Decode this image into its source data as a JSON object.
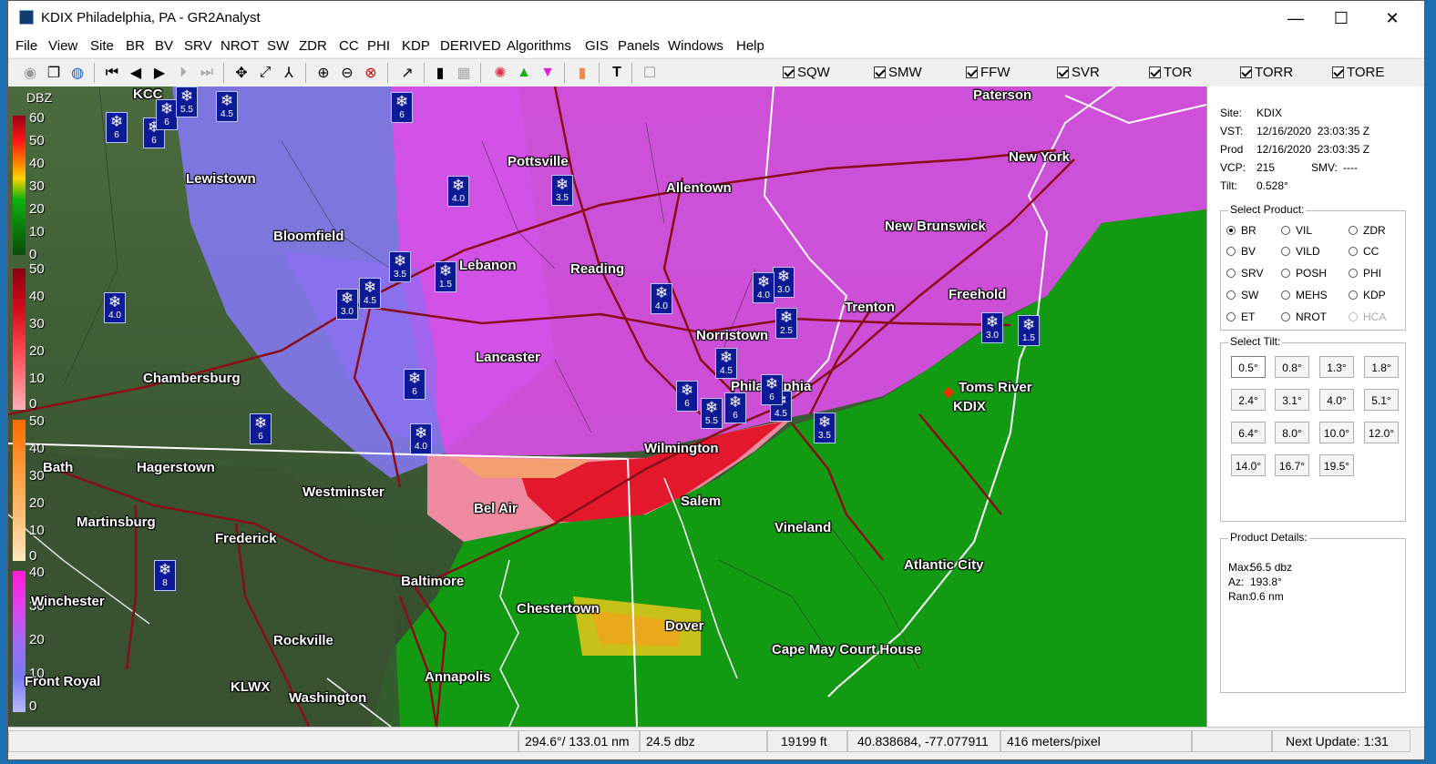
{
  "window": {
    "title": "KDIX Philadelphia, PA - GR2Analyst",
    "minimize": "—",
    "maximize": "☐",
    "close": "✕"
  },
  "menu": [
    "File",
    "View",
    "Site",
    "BR",
    "BV",
    "SRV",
    "NROT",
    "SW",
    "ZDR",
    "CC",
    "PHI",
    "KDP",
    "DERIVED",
    "Algorithms",
    "GIS",
    "Panels",
    "Windows",
    "Help"
  ],
  "warnings": [
    {
      "label": "SQW",
      "checked": true
    },
    {
      "label": "SMW",
      "checked": true
    },
    {
      "label": "FFW",
      "checked": true
    },
    {
      "label": "SVR",
      "checked": true
    },
    {
      "label": "TOR",
      "checked": true
    },
    {
      "label": "TORR",
      "checked": true
    },
    {
      "label": "TORE",
      "checked": true
    }
  ],
  "legend": {
    "title": "DBZ",
    "rain_ticks": [
      "60",
      "50",
      "40",
      "30",
      "20",
      "10",
      "0"
    ],
    "ice_ticks": [
      "50",
      "40",
      "30",
      "20",
      "10",
      "0"
    ],
    "mix_ticks": [
      "50",
      "40",
      "30",
      "20",
      "10",
      "0"
    ],
    "snow_ticks": [
      "40",
      "30",
      "20",
      "10",
      "0"
    ]
  },
  "cities": [
    {
      "name": "KCC"
    },
    {
      "name": "Lewistown"
    },
    {
      "name": "Pottsville"
    },
    {
      "name": "Allentown"
    },
    {
      "name": "Paterson"
    },
    {
      "name": "New York"
    },
    {
      "name": "New Brunswick"
    },
    {
      "name": "Bloomfield"
    },
    {
      "name": "Lebanon"
    },
    {
      "name": "Reading"
    },
    {
      "name": "Trenton"
    },
    {
      "name": "Freehold"
    },
    {
      "name": "Norristown"
    },
    {
      "name": "Lancaster"
    },
    {
      "name": "Chambersburg"
    },
    {
      "name": "Philadelphia"
    },
    {
      "name": "Toms River"
    },
    {
      "name": "KDIX"
    },
    {
      "name": "Wilmington"
    },
    {
      "name": "Hagerstown"
    },
    {
      "name": "Westminster"
    },
    {
      "name": "Bel Air"
    },
    {
      "name": "Salem"
    },
    {
      "name": "Martinsburg"
    },
    {
      "name": "Frederick"
    },
    {
      "name": "Vineland"
    },
    {
      "name": "Atlantic City"
    },
    {
      "name": "Baltimore"
    },
    {
      "name": "Chestertown"
    },
    {
      "name": "Winchester"
    },
    {
      "name": "Dover"
    },
    {
      "name": "Rockville"
    },
    {
      "name": "Cape May Court House"
    },
    {
      "name": "Annapolis"
    },
    {
      "name": "KLWX"
    },
    {
      "name": "Washington"
    },
    {
      "name": "Bath"
    },
    {
      "name": "Front Royal"
    }
  ],
  "snow_markers": [
    {
      "value": "6"
    },
    {
      "value": "6"
    },
    {
      "value": "6"
    },
    {
      "value": "4.5"
    },
    {
      "value": "5.5"
    },
    {
      "value": "6"
    },
    {
      "value": "4.0"
    },
    {
      "value": "3.5"
    },
    {
      "value": "3.5"
    },
    {
      "value": "1.5"
    },
    {
      "value": "3.0"
    },
    {
      "value": "4.5"
    },
    {
      "value": "4.0"
    },
    {
      "value": "4.0"
    },
    {
      "value": "3.0"
    },
    {
      "value": "4.0"
    },
    {
      "value": "2.5"
    },
    {
      "value": "3.0"
    },
    {
      "value": "1.5"
    },
    {
      "value": "4.5"
    },
    {
      "value": "6"
    },
    {
      "value": "6"
    },
    {
      "value": "5.5"
    },
    {
      "value": "6"
    },
    {
      "value": "4.5"
    },
    {
      "value": "3.5"
    },
    {
      "value": "6"
    },
    {
      "value": "4.0"
    },
    {
      "value": "6"
    },
    {
      "value": "8"
    }
  ],
  "site_info": {
    "site_label": "Site:",
    "site": "KDIX",
    "vst_label": "VST:",
    "vst": "12/16/2020  23:03:35 Z",
    "prod_label": "Prod",
    "prod": "12/16/2020  23:03:35 Z",
    "vcp_label": "VCP:",
    "vcp": "215",
    "smv_label": "SMV:",
    "smv": "----",
    "tilt_label": "Tilt:",
    "tilt": "0.528°"
  },
  "select_product": {
    "title": "Select Product:",
    "options": [
      {
        "label": "BR",
        "selected": true
      },
      {
        "label": "VIL"
      },
      {
        "label": "ZDR"
      },
      {
        "label": "BV"
      },
      {
        "label": "VILD"
      },
      {
        "label": "CC"
      },
      {
        "label": "SRV"
      },
      {
        "label": "POSH"
      },
      {
        "label": "PHI"
      },
      {
        "label": "SW"
      },
      {
        "label": "MEHS"
      },
      {
        "label": "KDP"
      },
      {
        "label": "ET"
      },
      {
        "label": "NROT"
      },
      {
        "label": "HCA",
        "disabled": true
      }
    ]
  },
  "select_tilt": {
    "title": "Select Tilt:",
    "tilts": [
      "0.5°",
      "0.8°",
      "1.3°",
      "1.8°",
      "2.4°",
      "3.1°",
      "4.0°",
      "5.1°",
      "6.4°",
      "8.0°",
      "10.0°",
      "12.0°",
      "14.0°",
      "16.7°",
      "19.5°"
    ],
    "selected": "0.5°"
  },
  "product_details": {
    "title": "Product Details:",
    "max_label": "Max:",
    "max": "56.5 dbz",
    "az_label": "Az:",
    "az": "193.8°",
    "ran_label": "Ran:",
    "ran": "0.6 nm"
  },
  "status": {
    "azimuth_range": "294.6°/ 133.01 nm",
    "value": "24.5 dbz",
    "height": "19199 ft",
    "latlon": "40.838684, -77.077911",
    "scale": "416 meters/pixel",
    "next_update": "Next Update: 1:31"
  },
  "colors": {
    "snow_marker": "#0d1a96",
    "radar_green": "#139a13",
    "radar_pink": "#e23ce0",
    "radar_purple": "#8b6bf0",
    "radar_red": "#e3182c",
    "roads": "#8a0d17",
    "site_marker": "#ff2a00"
  }
}
